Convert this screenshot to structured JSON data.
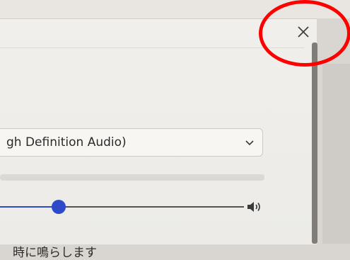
{
  "dialog": {
    "close_icon": "close-icon",
    "device_select": {
      "value": "gh Definition Audio)",
      "icon": "chevron-down-icon"
    },
    "volume": {
      "level": 0.24,
      "icon": "speaker-volume-icon"
    },
    "option_text": "時に鳴らします"
  },
  "colors": {
    "accent": "#2f4ac8",
    "annotation": "#ff0000"
  }
}
